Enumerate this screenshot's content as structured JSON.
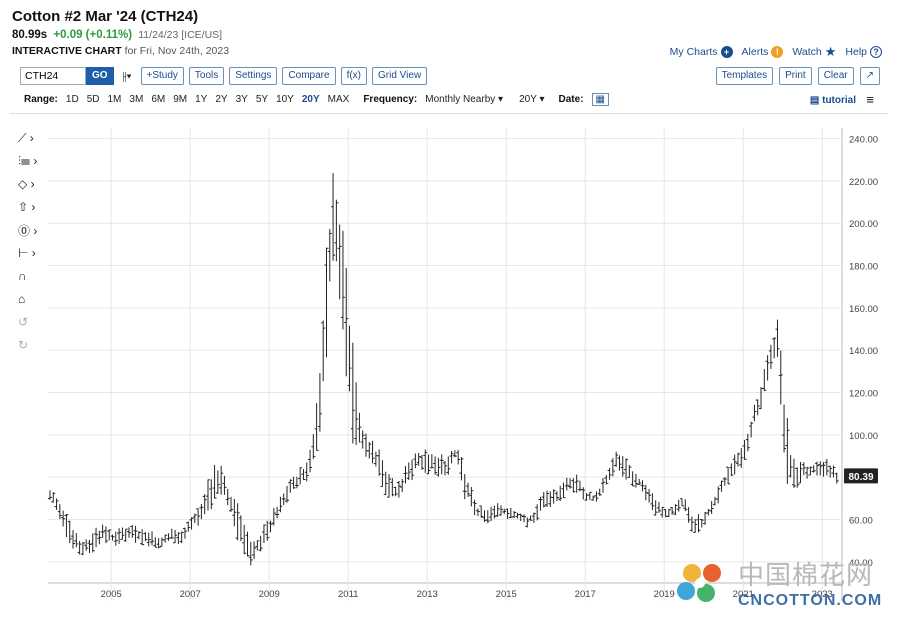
{
  "header": {
    "title": "Cotton #2 Mar '24 (CTH24)",
    "last": "80.99s",
    "change": "+0.09 (+0.11%)",
    "timestamp": "11/24/23 [ICE/US]",
    "subtitle_bold": "INTERACTIVE CHART",
    "subtitle_rest": "for Fri, Nov 24th, 2023"
  },
  "toplinks": {
    "my_charts": "My Charts",
    "alerts": "Alerts",
    "watch": "Watch",
    "help": "Help"
  },
  "toolbar": {
    "symbol": "CTH24",
    "go": "GO",
    "study": "+Study",
    "tools": "Tools",
    "settings": "Settings",
    "compare": "Compare",
    "fx": "f(x)",
    "grid_view": "Grid View",
    "templates": "Templates",
    "print": "Print",
    "clear": "Clear"
  },
  "rangebar": {
    "range_label": "Range:",
    "ranges": [
      "1D",
      "5D",
      "1M",
      "3M",
      "6M",
      "9M",
      "1Y",
      "2Y",
      "3Y",
      "5Y",
      "10Y",
      "20Y",
      "MAX"
    ],
    "selected_range": "20Y",
    "frequency_label": "Frequency:",
    "frequency": "Monthly Nearby",
    "period": "20Y",
    "date_label": "Date:",
    "tutorial": "tutorial"
  },
  "watermark": {
    "cn": "中国棉花网",
    "en": "CNCOTTON.COM"
  },
  "colors": {
    "link": "#1a4d8f",
    "up": "#2e9b3d",
    "bars": "#222222",
    "last_badge": "#222222"
  },
  "chart_data": {
    "type": "ohlc",
    "frequency": "monthly",
    "y_axis_side": "right",
    "ylim": [
      30,
      245
    ],
    "y_ticks": [
      "40.00",
      "60.00",
      "80.00",
      "100.00",
      "120.00",
      "140.00",
      "160.00",
      "180.00",
      "200.00",
      "220.00",
      "240.00"
    ],
    "x_ticks": [
      "2005",
      "2007",
      "2009",
      "2011",
      "2013",
      "2015",
      "2017",
      "2019",
      "2021",
      "2023"
    ],
    "x_range": [
      2003.9,
      2024.0
    ],
    "last_value_label": "80.39",
    "grid": true,
    "series": [
      {
        "x": 2004.0,
        "high": 75,
        "low": 68
      },
      {
        "x": 2004.25,
        "high": 68,
        "low": 58
      },
      {
        "x": 2004.5,
        "high": 58,
        "low": 44
      },
      {
        "x": 2004.75,
        "high": 50,
        "low": 42
      },
      {
        "x": 2005.0,
        "high": 53,
        "low": 43
      },
      {
        "x": 2005.25,
        "high": 60,
        "low": 48
      },
      {
        "x": 2005.5,
        "high": 55,
        "low": 48
      },
      {
        "x": 2005.75,
        "high": 57,
        "low": 47
      },
      {
        "x": 2006.0,
        "high": 58,
        "low": 49
      },
      {
        "x": 2006.25,
        "high": 56,
        "low": 48
      },
      {
        "x": 2006.5,
        "high": 55,
        "low": 47
      },
      {
        "x": 2006.75,
        "high": 52,
        "low": 46
      },
      {
        "x": 2007.0,
        "high": 56,
        "low": 49
      },
      {
        "x": 2007.25,
        "high": 55,
        "low": 47
      },
      {
        "x": 2007.5,
        "high": 62,
        "low": 52
      },
      {
        "x": 2007.75,
        "high": 68,
        "low": 58
      },
      {
        "x": 2008.0,
        "high": 82,
        "low": 63
      },
      {
        "x": 2008.2,
        "high": 91,
        "low": 68
      },
      {
        "x": 2008.45,
        "high": 78,
        "low": 66
      },
      {
        "x": 2008.7,
        "high": 70,
        "low": 50
      },
      {
        "x": 2009.0,
        "high": 52,
        "low": 36
      },
      {
        "x": 2009.25,
        "high": 55,
        "low": 42
      },
      {
        "x": 2009.5,
        "high": 62,
        "low": 50
      },
      {
        "x": 2009.75,
        "high": 72,
        "low": 60
      },
      {
        "x": 2010.0,
        "high": 80,
        "low": 68
      },
      {
        "x": 2010.25,
        "high": 84,
        "low": 75
      },
      {
        "x": 2010.5,
        "high": 90,
        "low": 78
      },
      {
        "x": 2010.7,
        "high": 115,
        "low": 88
      },
      {
        "x": 2010.85,
        "high": 155,
        "low": 110
      },
      {
        "x": 2011.0,
        "high": 210,
        "low": 150
      },
      {
        "x": 2011.15,
        "high": 228,
        "low": 185
      },
      {
        "x": 2011.35,
        "high": 200,
        "low": 150
      },
      {
        "x": 2011.55,
        "high": 160,
        "low": 95
      },
      {
        "x": 2011.75,
        "high": 115,
        "low": 90
      },
      {
        "x": 2012.0,
        "high": 100,
        "low": 88
      },
      {
        "x": 2012.25,
        "high": 95,
        "low": 80
      },
      {
        "x": 2012.5,
        "high": 85,
        "low": 67
      },
      {
        "x": 2012.75,
        "high": 78,
        "low": 68
      },
      {
        "x": 2013.0,
        "high": 88,
        "low": 75
      },
      {
        "x": 2013.25,
        "high": 92,
        "low": 82
      },
      {
        "x": 2013.5,
        "high": 94,
        "low": 82
      },
      {
        "x": 2013.75,
        "high": 90,
        "low": 78
      },
      {
        "x": 2014.0,
        "high": 92,
        "low": 80
      },
      {
        "x": 2014.25,
        "high": 97,
        "low": 88
      },
      {
        "x": 2014.5,
        "high": 85,
        "low": 65
      },
      {
        "x": 2014.75,
        "high": 68,
        "low": 60
      },
      {
        "x": 2015.0,
        "high": 65,
        "low": 57
      },
      {
        "x": 2015.25,
        "high": 68,
        "low": 61
      },
      {
        "x": 2015.5,
        "high": 67,
        "low": 60
      },
      {
        "x": 2015.75,
        "high": 65,
        "low": 59
      },
      {
        "x": 2016.0,
        "high": 63,
        "low": 56
      },
      {
        "x": 2016.25,
        "high": 66,
        "low": 58
      },
      {
        "x": 2016.5,
        "high": 77,
        "low": 65
      },
      {
        "x": 2016.75,
        "high": 74,
        "low": 67
      },
      {
        "x": 2017.0,
        "high": 80,
        "low": 70
      },
      {
        "x": 2017.25,
        "high": 84,
        "low": 73
      },
      {
        "x": 2017.5,
        "high": 75,
        "low": 67
      },
      {
        "x": 2017.75,
        "high": 72,
        "low": 67
      },
      {
        "x": 2018.0,
        "high": 82,
        "low": 73
      },
      {
        "x": 2018.3,
        "high": 96,
        "low": 83
      },
      {
        "x": 2018.6,
        "high": 90,
        "low": 75
      },
      {
        "x": 2018.85,
        "high": 82,
        "low": 75
      },
      {
        "x": 2019.0,
        "high": 78,
        "low": 70
      },
      {
        "x": 2019.25,
        "high": 72,
        "low": 62
      },
      {
        "x": 2019.5,
        "high": 66,
        "low": 58
      },
      {
        "x": 2019.75,
        "high": 68,
        "low": 61
      },
      {
        "x": 2020.0,
        "high": 72,
        "low": 65
      },
      {
        "x": 2020.2,
        "high": 65,
        "low": 49
      },
      {
        "x": 2020.45,
        "high": 62,
        "low": 55
      },
      {
        "x": 2020.7,
        "high": 70,
        "low": 62
      },
      {
        "x": 2021.0,
        "high": 82,
        "low": 72
      },
      {
        "x": 2021.25,
        "high": 90,
        "low": 78
      },
      {
        "x": 2021.5,
        "high": 95,
        "low": 85
      },
      {
        "x": 2021.75,
        "high": 115,
        "low": 100
      },
      {
        "x": 2022.0,
        "high": 130,
        "low": 115
      },
      {
        "x": 2022.2,
        "high": 145,
        "low": 125
      },
      {
        "x": 2022.35,
        "high": 158,
        "low": 135
      },
      {
        "x": 2022.55,
        "high": 125,
        "low": 80
      },
      {
        "x": 2022.75,
        "high": 90,
        "low": 70
      },
      {
        "x": 2023.0,
        "high": 88,
        "low": 78
      },
      {
        "x": 2023.25,
        "high": 88,
        "low": 80
      },
      {
        "x": 2023.5,
        "high": 90,
        "low": 80
      },
      {
        "x": 2023.75,
        "high": 88,
        "low": 79
      },
      {
        "x": 2023.9,
        "high": 82,
        "low": 76
      }
    ]
  }
}
